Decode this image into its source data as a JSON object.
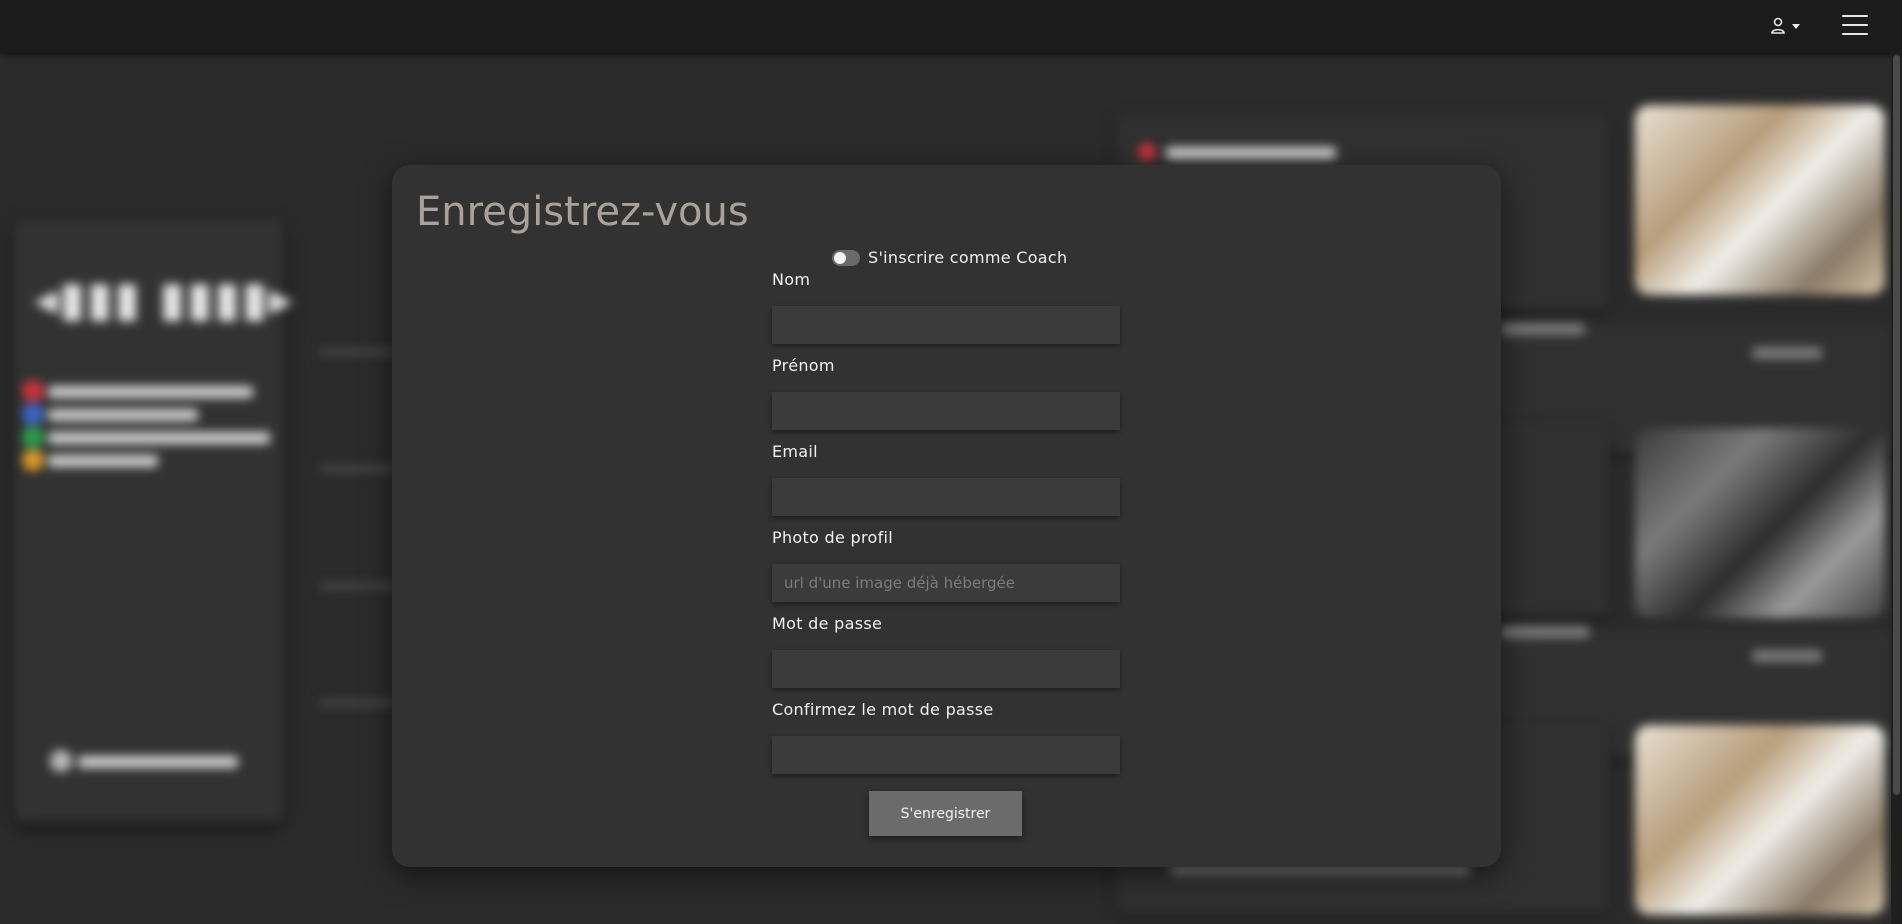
{
  "header": {
    "icons": [
      "user-icon",
      "caret-down-icon",
      "hamburger-icon"
    ]
  },
  "modal": {
    "title": "Enregistrez-vous",
    "coach_toggle": {
      "label": "S'inscrire comme Coach",
      "checked": false
    },
    "fields": {
      "nom": {
        "label": "Nom",
        "value": "",
        "placeholder": ""
      },
      "prenom": {
        "label": "Prénom",
        "value": "",
        "placeholder": ""
      },
      "email": {
        "label": "Email",
        "value": "",
        "placeholder": ""
      },
      "photo": {
        "label": "Photo de profil",
        "value": "",
        "placeholder": "url d'une image déjà hébergée"
      },
      "password": {
        "label": "Mot de passe",
        "value": "",
        "placeholder": ""
      },
      "confirm": {
        "label": "Confirmez le mot de passe",
        "value": "",
        "placeholder": ""
      }
    },
    "submit_label": "S'enregistrer"
  },
  "colors": {
    "topbar": "#1b1b1b",
    "page_bg": "#2b2b2b",
    "modal_bg": "#323232",
    "input_bg": "#3b3b3b",
    "button_bg": "#6b6b6b",
    "title_text": "#a8a29b"
  }
}
